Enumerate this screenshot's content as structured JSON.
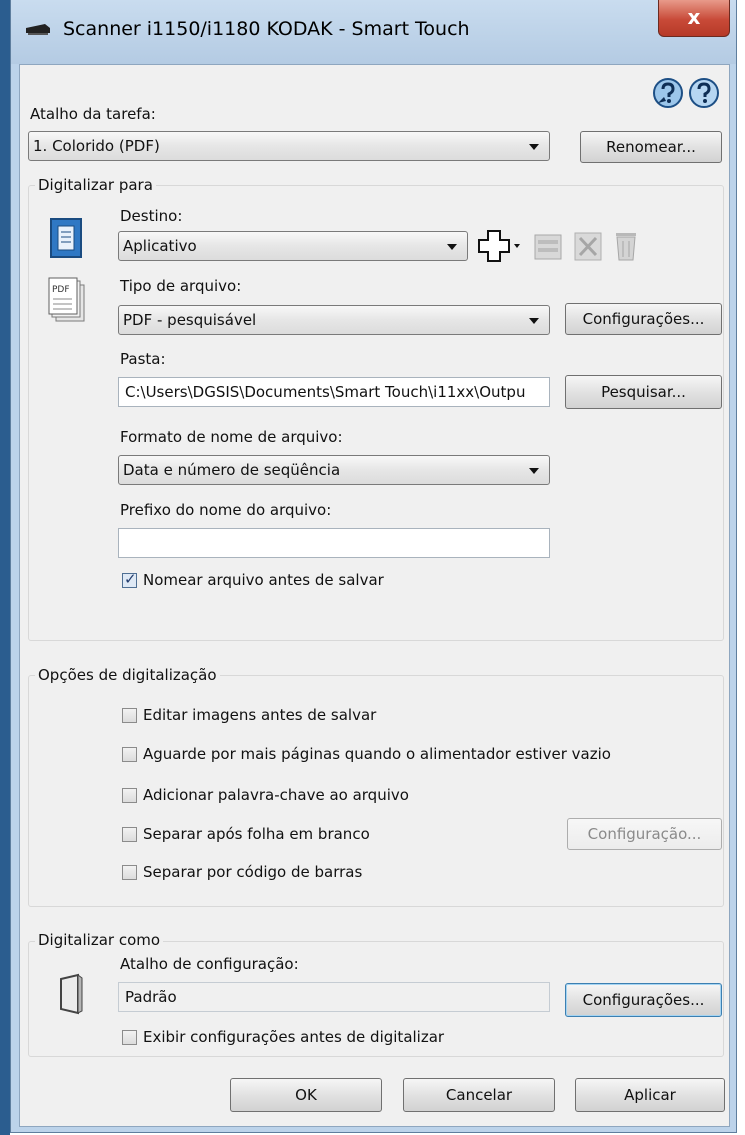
{
  "window": {
    "title": "Scanner i1150/i1180 KODAK - Smart Touch",
    "close_label": "x"
  },
  "task": {
    "label": "Atalho da tarefa:",
    "selected": "1. Colorido (PDF)",
    "rename_button": "Renomear..."
  },
  "scan_to": {
    "group_title": "Digitalizar para",
    "destination_label": "Destino:",
    "destination_value": "Aplicativo",
    "file_type_label": "Tipo de arquivo:",
    "file_type_value": "PDF - pesquisável",
    "file_type_settings_button": "Configurações...",
    "pdf_icon_text": "PDF",
    "folder_label": "Pasta:",
    "folder_value": "C:\\Users\\DGSIS\\Documents\\Smart Touch\\i11xx\\Outpu",
    "browse_button": "Pesquisar...",
    "filename_format_label": "Formato de nome de arquivo:",
    "filename_format_value": "Data e número de seqüência",
    "prefix_label": "Prefixo do nome do arquivo:",
    "prefix_value": "",
    "name_before_save_label": "Nomear arquivo antes de salvar",
    "name_before_save_checked": true
  },
  "scan_options": {
    "group_title": "Opções de digitalização",
    "items": [
      {
        "label": "Editar imagens antes de salvar",
        "checked": false
      },
      {
        "label": "Aguarde por mais páginas quando o alimentador estiver vazio",
        "checked": false
      },
      {
        "label": "Adicionar palavra-chave ao arquivo",
        "checked": false
      },
      {
        "label": "Separar após folha em branco",
        "checked": false
      },
      {
        "label": "Separar por código de barras",
        "checked": false
      }
    ],
    "config_button": "Configuração..."
  },
  "scan_as": {
    "group_title": "Digitalizar como",
    "shortcut_label": "Atalho de configuração:",
    "shortcut_value": "Padrão",
    "settings_button": "Configurações...",
    "show_settings_label": "Exibir configurações antes de digitalizar",
    "show_settings_checked": false
  },
  "footer": {
    "ok": "OK",
    "cancel": "Cancelar",
    "apply": "Aplicar"
  },
  "colors": {
    "title_bar": "#b4cbe3",
    "close_button": "#c84a38",
    "dialog_bg": "#f0f0f0",
    "accent": "#3c7fb1"
  }
}
